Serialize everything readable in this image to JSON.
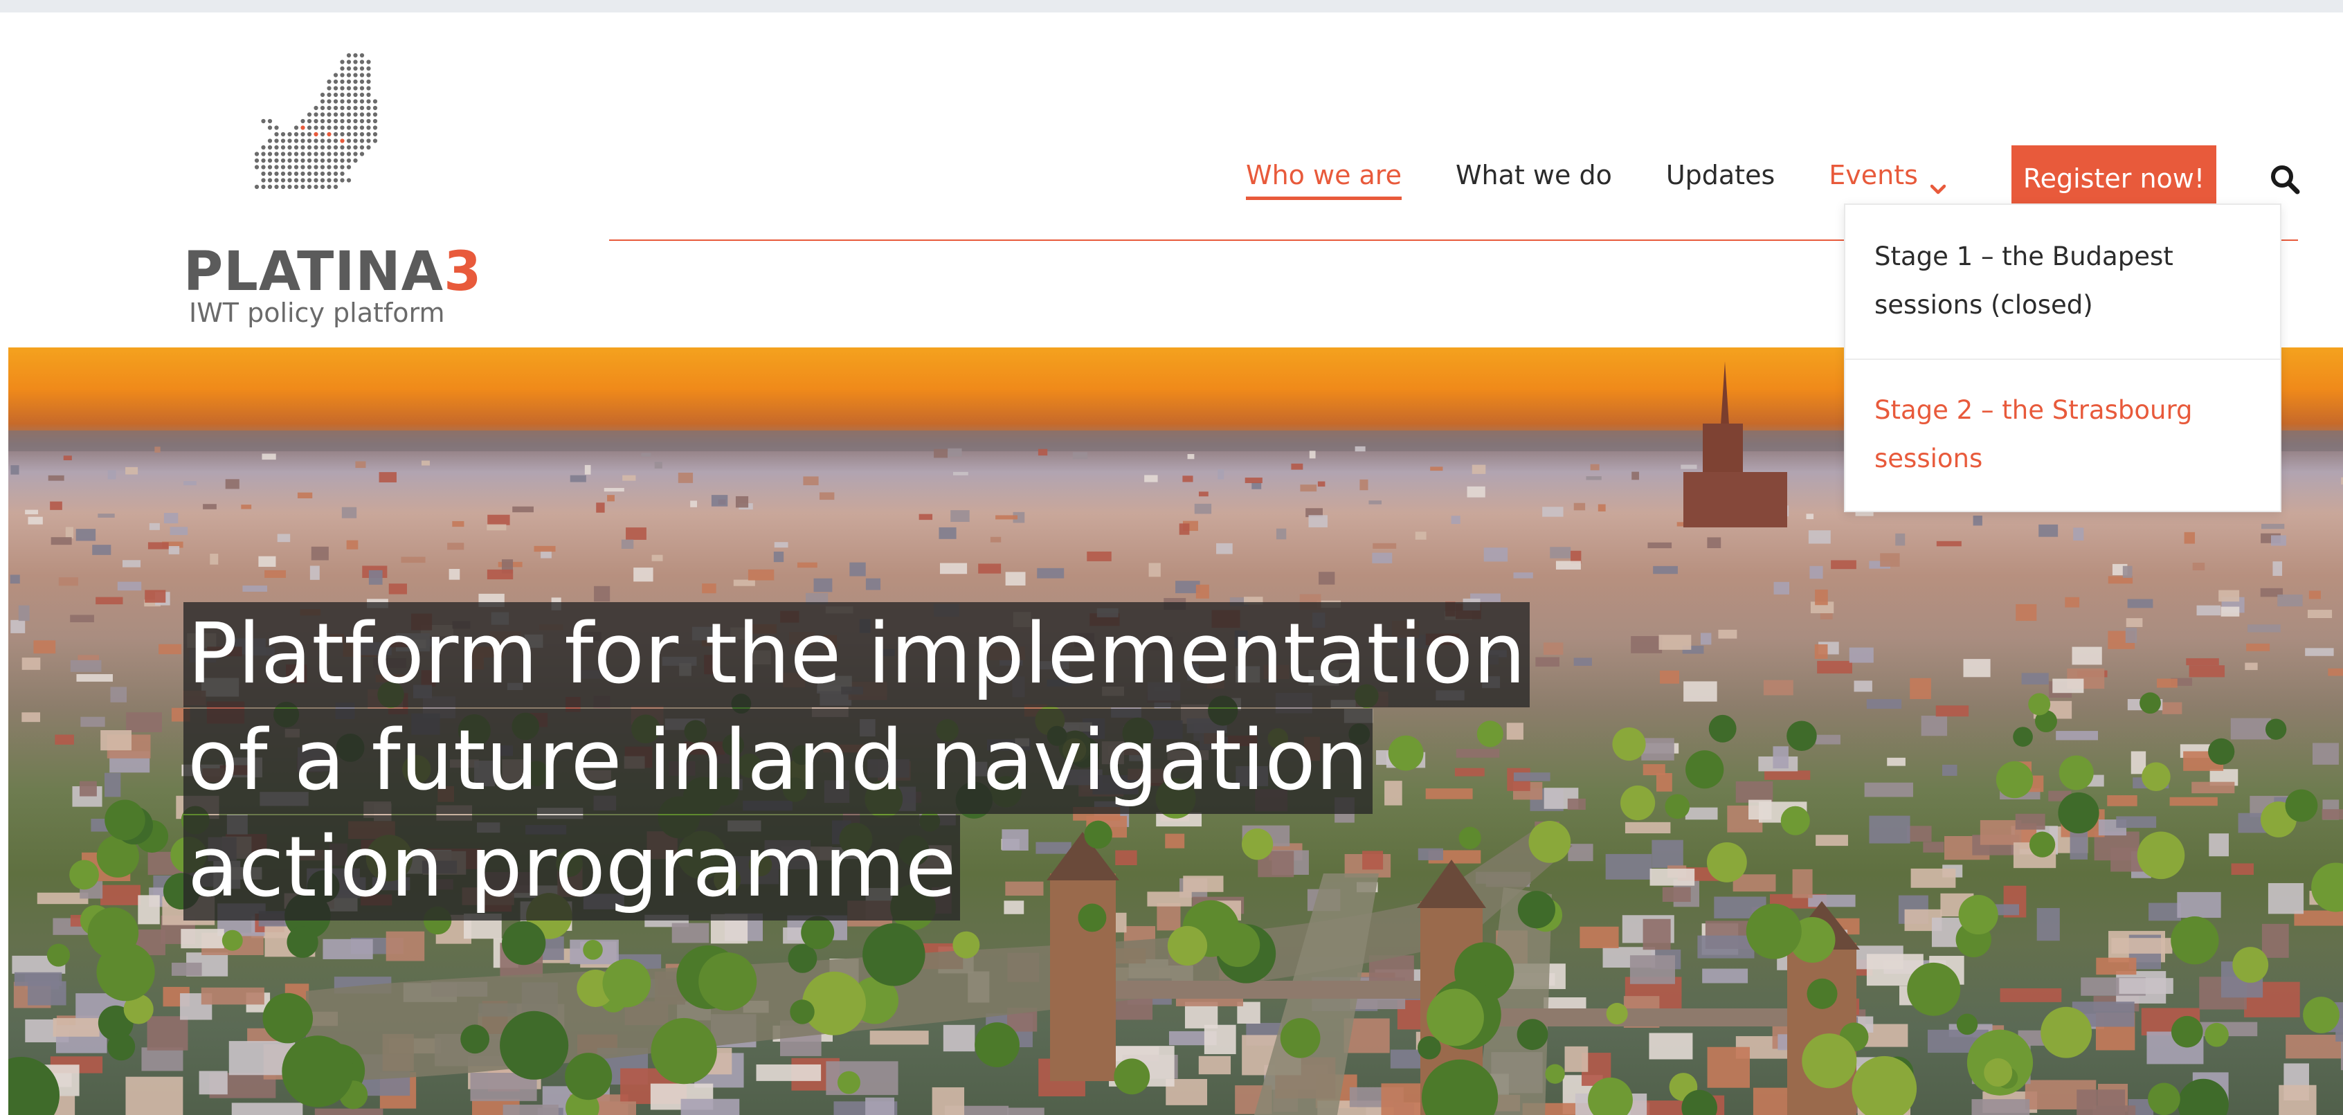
{
  "logo": {
    "name_main": "PLATINA",
    "name_accent": "3",
    "tagline": "IWT policy platform"
  },
  "nav": {
    "items": [
      {
        "label": "Who we are",
        "state": "active"
      },
      {
        "label": "What we do"
      },
      {
        "label": "Updates"
      },
      {
        "label": "Events",
        "state": "open"
      }
    ],
    "register_label": "Register now!",
    "search_icon": "search-icon"
  },
  "events_menu": {
    "items": [
      {
        "label": "Stage 1 – the Budapest sessions (closed)"
      },
      {
        "label": "Stage 2 – the Strasbourg sessions"
      }
    ]
  },
  "hero": {
    "headline_lines": [
      "Platform for the implementation",
      "of a future inland navigation",
      "action programme"
    ]
  },
  "colors": {
    "accent": "#e85a3b",
    "text": "#2b2b2b"
  }
}
